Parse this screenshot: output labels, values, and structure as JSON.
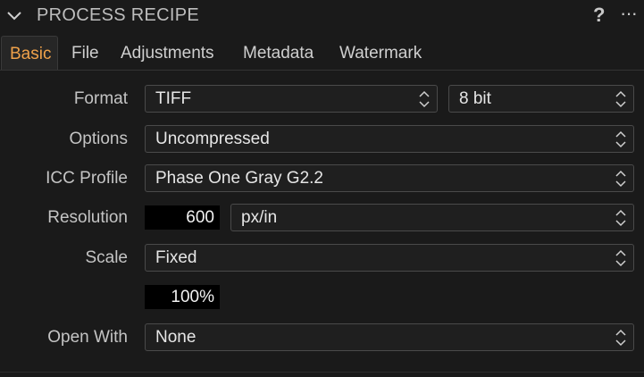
{
  "header": {
    "title": "PROCESS RECIPE",
    "help_label": "?",
    "more_label": "···"
  },
  "tabs": [
    {
      "label": "Basic",
      "active": true
    },
    {
      "label": "File",
      "active": false
    },
    {
      "label": "Adjustments",
      "active": false
    },
    {
      "label": "Metadata",
      "active": false
    },
    {
      "label": "Watermark",
      "active": false
    }
  ],
  "form": {
    "format": {
      "label": "Format",
      "value": "TIFF",
      "bit_depth": "8 bit"
    },
    "options": {
      "label": "Options",
      "value": "Uncompressed"
    },
    "icc_profile": {
      "label": "ICC Profile",
      "value": "Phase One Gray G2.2"
    },
    "resolution": {
      "label": "Resolution",
      "value": "600",
      "unit": "px/in"
    },
    "scale": {
      "label": "Scale",
      "value": "Fixed",
      "percent": "100%"
    },
    "open_with": {
      "label": "Open With",
      "value": "None"
    }
  },
  "colors": {
    "accent": "#f0a24a",
    "background": "#1a1a1a",
    "field_border": "#4a4a4a"
  }
}
